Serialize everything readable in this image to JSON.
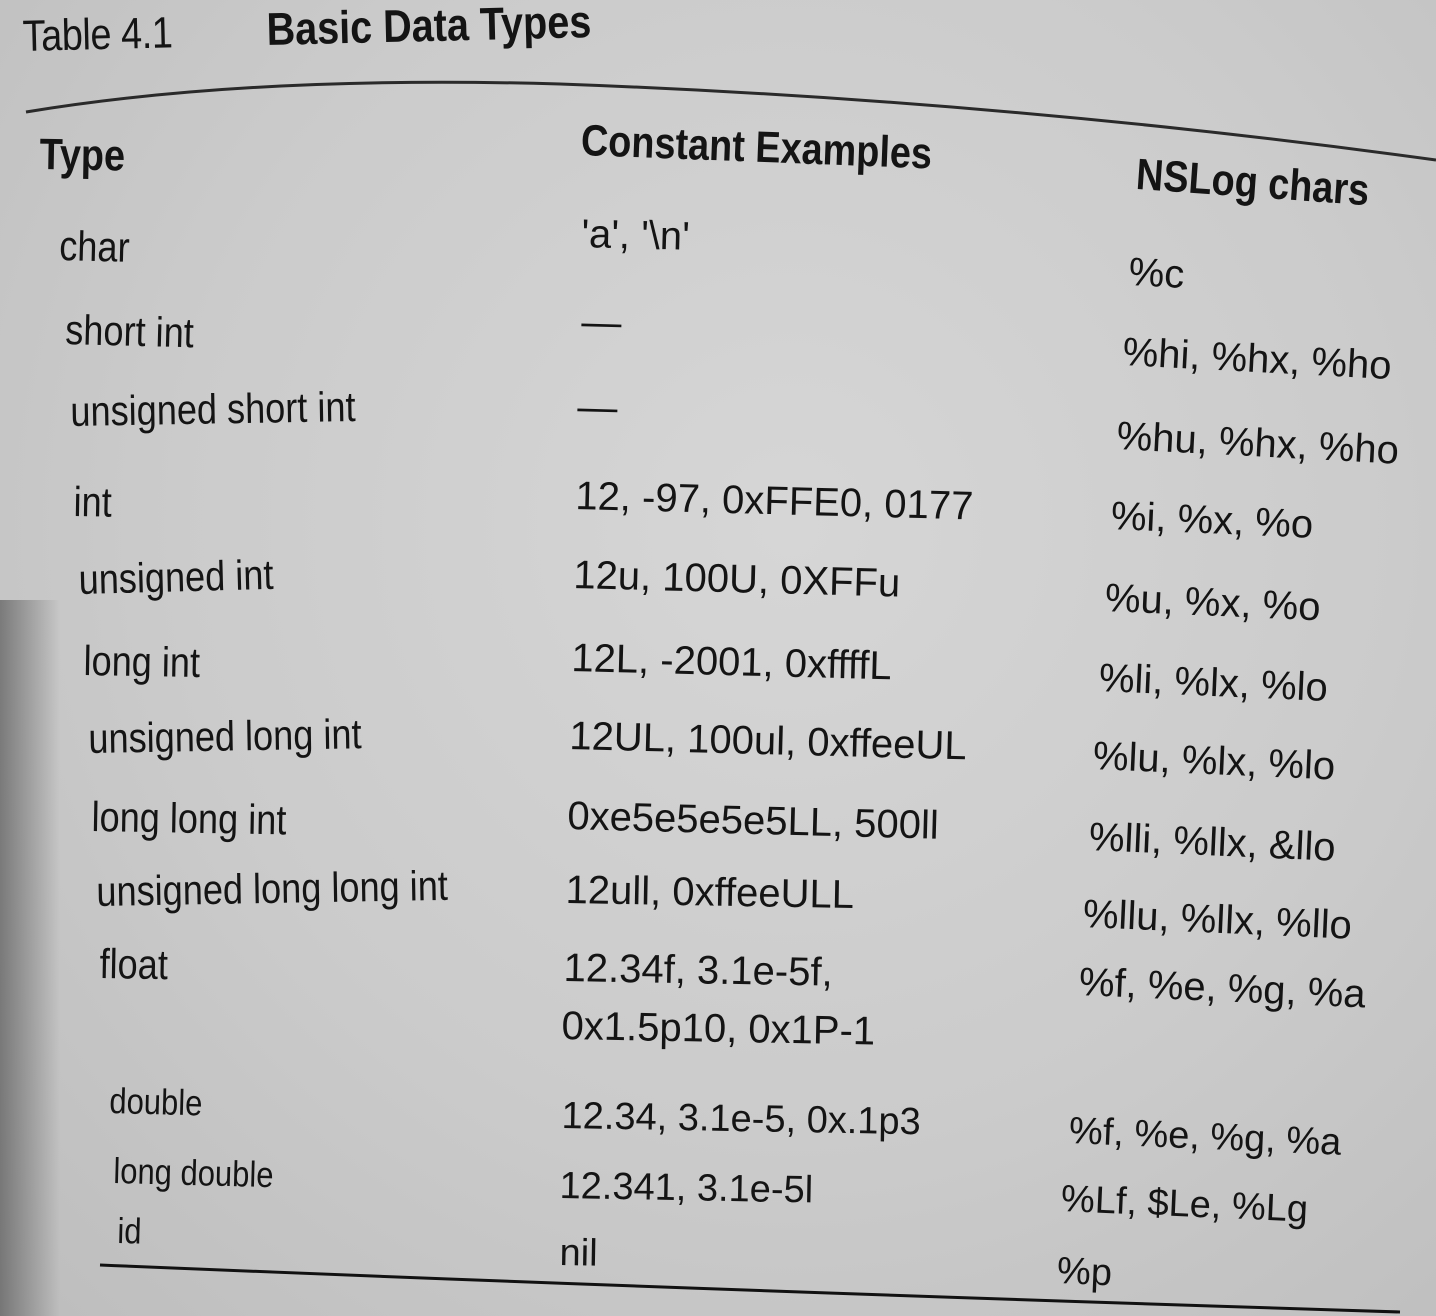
{
  "table": {
    "number_label": "Table 4.1",
    "title": "Basic Data Types",
    "columns": [
      "Type",
      "Constant Examples",
      "NSLog chars"
    ],
    "rows": [
      {
        "type": "char",
        "constants": [
          "'a', '\\n'"
        ],
        "nslog": "%c"
      },
      {
        "type": "short int",
        "constants": [
          "—"
        ],
        "nslog": "%hi, %hx, %ho"
      },
      {
        "type": "unsigned short int",
        "constants": [
          "—"
        ],
        "nslog": "%hu, %hx, %ho"
      },
      {
        "type": "int",
        "constants": [
          "12, -97, 0xFFE0, 0177"
        ],
        "nslog": "%i, %x, %o"
      },
      {
        "type": "unsigned int",
        "constants": [
          "12u, 100U, 0XFFu"
        ],
        "nslog": "%u, %x, %o"
      },
      {
        "type": "long int",
        "constants": [
          "12L, -2001, 0xffffL"
        ],
        "nslog": "%li, %lx, %lo"
      },
      {
        "type": "unsigned long int",
        "constants": [
          "12UL, 100ul, 0xffeeUL"
        ],
        "nslog": "%lu, %lx, %lo"
      },
      {
        "type": "long long int",
        "constants": [
          "0xe5e5e5e5LL, 500ll"
        ],
        "nslog": "%lli, %llx, &llo"
      },
      {
        "type": "unsigned long long int",
        "constants": [
          "12ull, 0xffeeULL"
        ],
        "nslog": "%llu, %llx, %llo"
      },
      {
        "type": "float",
        "constants": [
          "12.34f, 3.1e-5f,",
          "0x1.5p10, 0x1P-1"
        ],
        "nslog": "%f, %e, %g, %a"
      },
      {
        "type": "double",
        "constants": [
          "12.34, 3.1e-5, 0x.1p3"
        ],
        "nslog": "%f, %e, %g, %a"
      },
      {
        "type": "long double",
        "constants": [
          "12.341, 3.1e-5l"
        ],
        "nslog": "%Lf, $Le, %Lg"
      },
      {
        "type": "id",
        "constants": [
          "nil"
        ],
        "nslog": "%p"
      }
    ]
  }
}
